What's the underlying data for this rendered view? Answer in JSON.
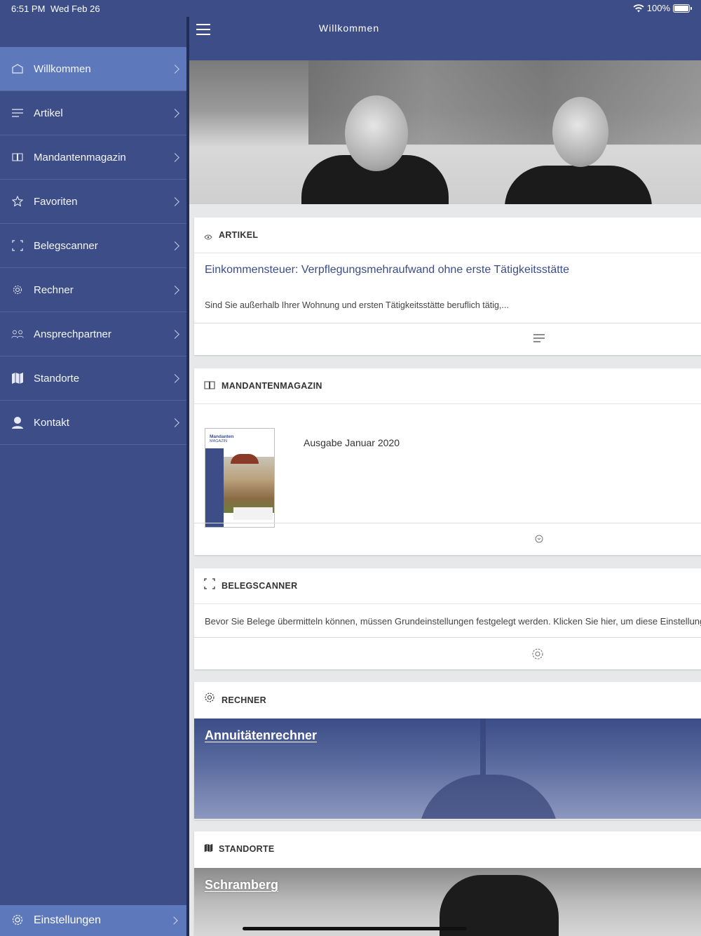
{
  "status": {
    "time": "6:51 PM",
    "date": "Wed Feb 26",
    "battery": "100%"
  },
  "header": {
    "title": "Willkommen"
  },
  "sidebar": {
    "items": [
      {
        "label": "Willkommen",
        "icon": "home-icon",
        "active": true
      },
      {
        "label": "Artikel",
        "icon": "lines-icon"
      },
      {
        "label": "Mandantenmagazin",
        "icon": "book-icon"
      },
      {
        "label": "Favoriten",
        "icon": "star-icon"
      },
      {
        "label": "Belegscanner",
        "icon": "scan-frame-icon"
      },
      {
        "label": "Rechner",
        "icon": "gear-icon"
      },
      {
        "label": "Ansprechpartner",
        "icon": "people-icon"
      },
      {
        "label": "Standorte",
        "icon": "map-icon"
      },
      {
        "label": "Kontakt",
        "icon": "person-icon"
      }
    ],
    "settings_label": "Einstellungen"
  },
  "cards": {
    "artikel": {
      "title": "ARTIKEL",
      "headline": "Einkommensteuer: Verpflegungsmehraufwand ohne erste Tätigkeitsstätte",
      "teaser": "Sind Sie außerhalb Ihrer Wohnung und ersten Tätigkeitsstätte beruflich tätig,..."
    },
    "magazin": {
      "title": "MANDANTENMAGAZIN",
      "issue": "Ausgabe Januar 2020",
      "cover_title_1": "Mandanten",
      "cover_title_2": "MAGAZIN"
    },
    "scanner": {
      "title": "BELEGSCANNER",
      "text": "Bevor Sie Belege übermitteln können, müssen Grundeinstellungen festgelegt werden. Klicken Sie hier, um diese Einstellungen r"
    },
    "rechner": {
      "title": "RECHNER",
      "item": "Annuitätenrechner"
    },
    "standorte": {
      "title": "STANDORTE",
      "item": "Schramberg"
    }
  },
  "colors": {
    "primary": "#3c4d87",
    "active": "#5d79bb",
    "link": "#3c4d87"
  }
}
